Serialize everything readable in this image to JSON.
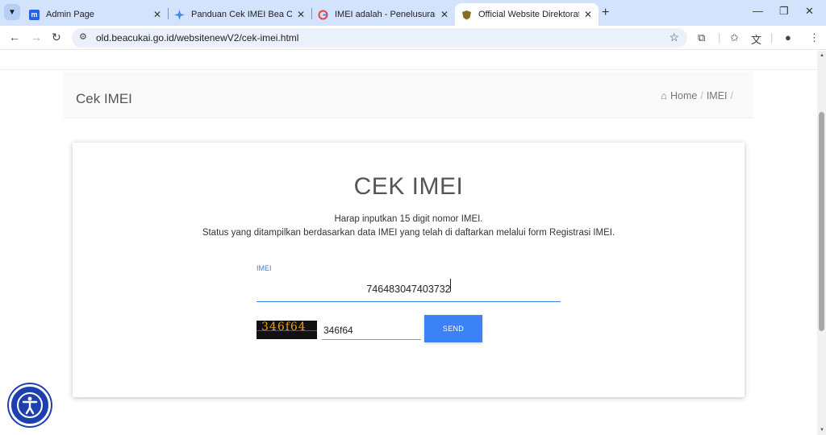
{
  "browser": {
    "tabs": [
      {
        "title": "Admin Page",
        "favicon": "m-icon"
      },
      {
        "title": "Panduan Cek IMEI Bea Cukai Le",
        "favicon": "sparkle-icon"
      },
      {
        "title": "IMEI adalah - Penelusuran Goo",
        "favicon": "google-icon"
      },
      {
        "title": "Official Website Direktorat Jend",
        "favicon": "beacukai-icon"
      }
    ],
    "active_tab": 3,
    "url": "old.beacukai.go.id/websitenewV2/cek-imei.html",
    "accent": "#d3e3fd"
  },
  "page": {
    "header_title": "Cek IMEI",
    "breadcrumb": {
      "home": "Home",
      "current": "IMEI",
      "separator": "/"
    }
  },
  "form": {
    "heading": "CEK IMEI",
    "desc_line1": "Harap inputkan 15 digit nomor IMEI.",
    "desc_line2": "Status yang ditampilkan berdasarkan data IMEI yang telah di daftarkan melalui form Registrasi IMEI.",
    "imei_label": "IMEI",
    "imei_value": "746483047403732",
    "captcha_image_text": "346f64",
    "captcha_value": "346f64",
    "send_label": "SEND",
    "accent": "#3b82f6"
  }
}
